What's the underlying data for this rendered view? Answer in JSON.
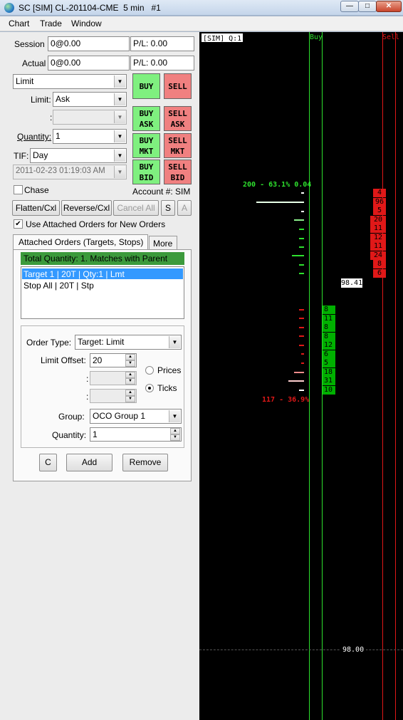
{
  "window": {
    "title": "SC [SIM] CL-201104-CME  5 min   #1",
    "min": "—",
    "max": "□",
    "close": "✕"
  },
  "menu": [
    "Chart",
    "Trade",
    "Window"
  ],
  "trade": {
    "session_label": "Session",
    "session_value": "0@0.00",
    "session_pl": "P/L: 0.00",
    "actual_label": "Actual",
    "actual_value": "0@0.00",
    "actual_pl": "P/L: 0.00",
    "order_type": "Limit",
    "limit_label": "Limit:",
    "limit_value": "Ask",
    "blank_label": ":",
    "quantity_label": "Quantity:",
    "quantity_value": "1",
    "tif_label": "TIF:",
    "tif_value": "Day",
    "date_value": "2011-02-23 01:19:03 AM",
    "chase_label": "Chase",
    "account_label": "Account #: SIM",
    "buttons": {
      "buy": "BUY",
      "sell": "SELL",
      "buy_ask": [
        "BUY",
        "ASK"
      ],
      "sell_ask": [
        "SELL",
        "ASK"
      ],
      "buy_mkt": [
        "BUY",
        "MKT"
      ],
      "sell_mkt": [
        "SELL",
        "MKT"
      ],
      "buy_bid": [
        "BUY",
        "BID"
      ],
      "sell_bid": [
        "SELL",
        "BID"
      ]
    },
    "flatten": "Flatten/Cxl",
    "reverse": "Reverse/Cxl",
    "cancel_all": "Cancel All",
    "s_button": "S",
    "a_button": "A",
    "use_attached_label": "Use Attached Orders for New Orders"
  },
  "attached": {
    "tab_active": "Attached Orders (Targets, Stops)",
    "tab_more": "More",
    "header": "Total Quantity: 1. Matches with Parent",
    "list": [
      "Target 1 | 20T | Qty:1 | Lmt",
      "Stop All | 20T | Stp"
    ],
    "order_type_label": "Order Type:",
    "order_type_value": "Target: Limit",
    "limit_offset_label": "Limit Offset:",
    "limit_offset_value": "20",
    "colon1": ":",
    "colon2": ":",
    "prices_label": "Prices",
    "ticks_label": "Ticks",
    "group_label": "Group:",
    "group_value": "OCO Group 1",
    "quantity_label": "Quantity:",
    "quantity_value": "1",
    "c_button": "C",
    "add_button": "Add",
    "remove_button": "Remove"
  },
  "chart": {
    "sim_label": "[SIM]  Q:1",
    "buy_label": "Buy",
    "sell_label": "Sell",
    "buy_summary": "200 - 63.1%  0.04",
    "sell_summary": "117 - 36.9%",
    "last_price": "98.41",
    "price_level": "98.00",
    "ask_sizes": [
      "4",
      "96",
      "5",
      "20",
      "11",
      "12",
      "11",
      "24",
      "8",
      "6"
    ],
    "bid_sizes": [
      "8",
      "11",
      "8",
      "8",
      "12",
      "6",
      "5",
      "18",
      "31",
      "10"
    ],
    "colors": {
      "buy": "#2ee02e",
      "sell": "#e01818",
      "background": "#000000"
    }
  }
}
